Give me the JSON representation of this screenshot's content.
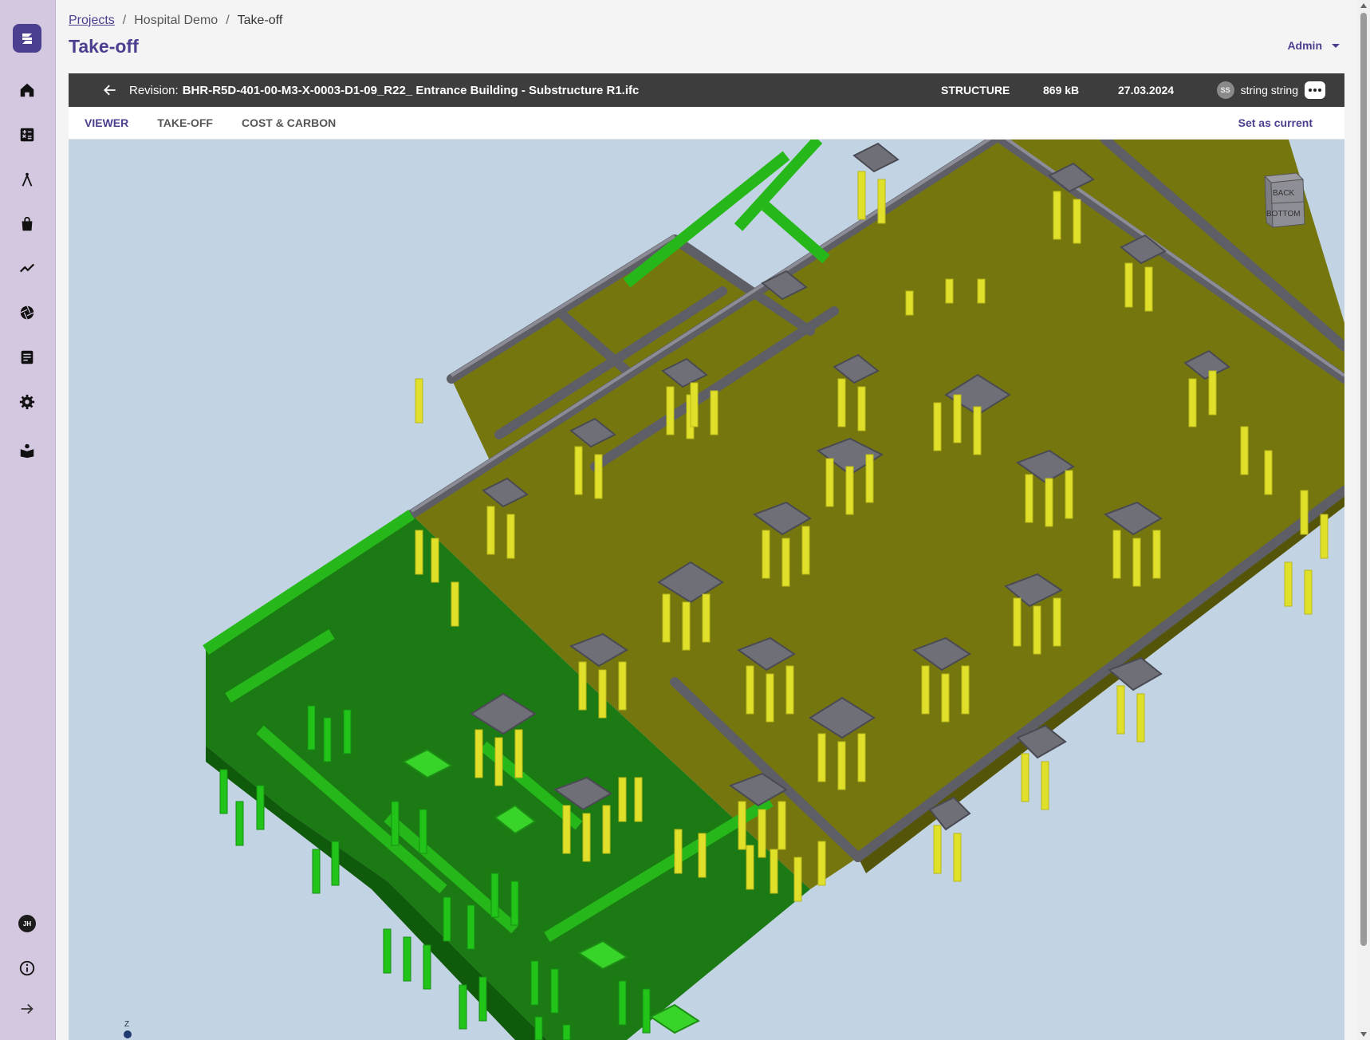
{
  "breadcrumb": {
    "projects": "Projects",
    "project": "Hospital Demo",
    "current": "Take-off",
    "separator": "/"
  },
  "page": {
    "title": "Take-off"
  },
  "user_menu": {
    "label": "Admin"
  },
  "revision": {
    "prefix": "Revision:",
    "name": "BHR-R5D-401-00-M3-X-0003-D1-09_R22_ Entrance Building - Substructure R1.ifc",
    "discipline": "STRUCTURE",
    "size": "869 kB",
    "date": "27.03.2024",
    "user_initials": "SS",
    "user_name": "string string"
  },
  "tabs": [
    {
      "label": "VIEWER",
      "active": true
    },
    {
      "label": "TAKE-OFF",
      "active": false
    },
    {
      "label": "COST & CARBON",
      "active": false
    }
  ],
  "set_current_label": "Set as current",
  "sidebar": {
    "items": [
      {
        "icon": "home-icon"
      },
      {
        "icon": "calculator-icon"
      },
      {
        "icon": "compass-icon"
      },
      {
        "icon": "shopping-bag-icon"
      },
      {
        "icon": "trending-icon"
      },
      {
        "icon": "aperture-icon"
      },
      {
        "icon": "report-icon"
      },
      {
        "icon": "gear-icon"
      },
      {
        "icon": "reader-icon"
      }
    ],
    "avatar_initials": "JH",
    "info_icon": "info-icon",
    "expand_icon": "arrow-right-icon"
  },
  "navcube": {
    "face_top": "BACK",
    "face_front": "BOTTOM"
  },
  "axis": {
    "label": "Z"
  },
  "colors": {
    "accent": "#4b3f8f",
    "rail": "#d4c7e0",
    "revbar": "#3d3d3d",
    "viewer_bg": "#c2d4e4",
    "slab": "#7a7a14",
    "pile": "#e0df2a",
    "pile_cap": "#707078",
    "green_element": "#1e7a14"
  }
}
